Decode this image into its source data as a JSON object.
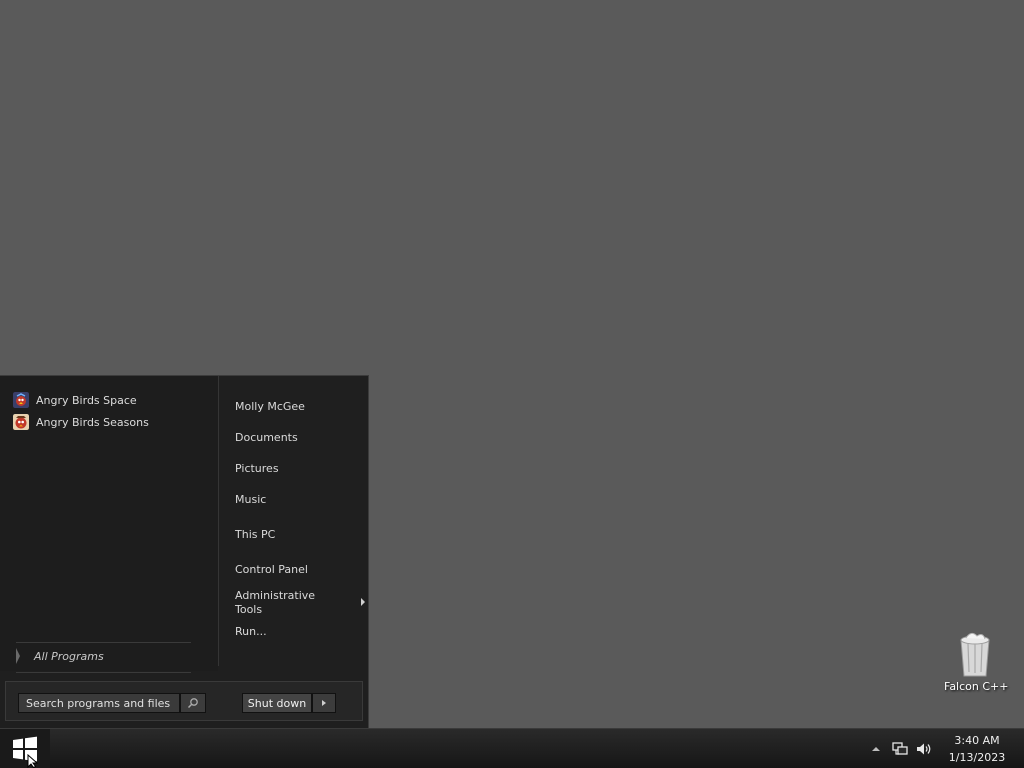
{
  "desktop": {
    "icons": [
      {
        "label": "Falcon C++",
        "icon": "recycle-bin-icon"
      }
    ]
  },
  "start_menu": {
    "pinned": [
      {
        "label": "Angry Birds Space",
        "icon": "angry-birds-space-icon"
      },
      {
        "label": "Angry Birds Seasons",
        "icon": "angry-birds-seasons-icon"
      }
    ],
    "all_programs": "All Programs",
    "right_items": [
      {
        "label": "Molly McGee"
      },
      {
        "label": "Documents"
      },
      {
        "label": "Pictures"
      },
      {
        "label": "Music"
      },
      {
        "label": "This PC"
      },
      {
        "label": "Control Panel"
      },
      {
        "label": "Administrative Tools",
        "has_submenu": true
      },
      {
        "label": "Run..."
      }
    ],
    "search_placeholder": "Search programs and files",
    "shutdown_label": "Shut down"
  },
  "taskbar": {
    "start_icon": "windows-logo-icon",
    "clock_time": "3:40 AM",
    "clock_date": "1/13/2023"
  },
  "colors": {
    "desktop_bg": "#5a5a5a",
    "menu_bg": "#1f1f1f",
    "taskbar_bg": "#1e1e1e"
  }
}
